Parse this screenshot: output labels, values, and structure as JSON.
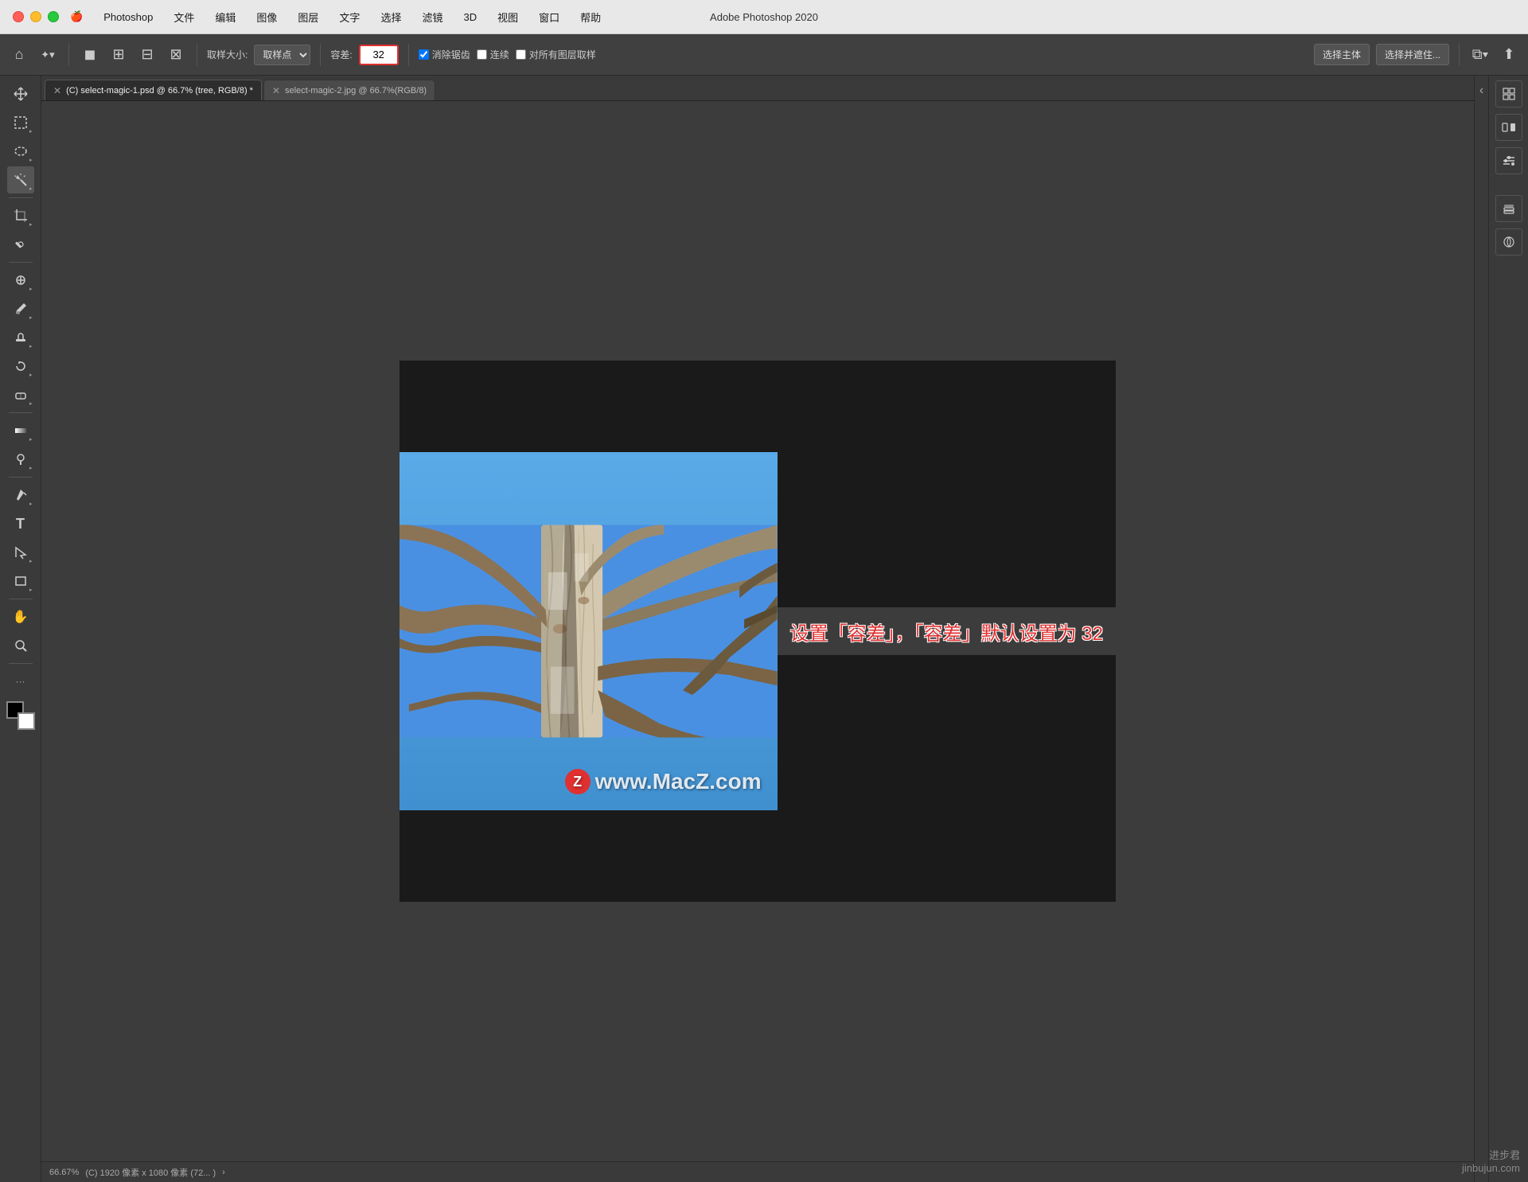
{
  "titlebar": {
    "app_name": "Photoshop",
    "menu_items": [
      "🍎",
      "Photoshop",
      "文件",
      "编辑",
      "图像",
      "图层",
      "文字",
      "选择",
      "滤镜",
      "3D",
      "视图",
      "窗口",
      "帮助"
    ],
    "window_title": "Adobe Photoshop 2020"
  },
  "toolbar": {
    "sample_size_label": "取样大小:",
    "sample_size_value": "取样点",
    "tolerance_label": "容差:",
    "tolerance_value": "32",
    "anti_alias_label": "消除锯齿",
    "anti_alias_checked": true,
    "contiguous_label": "连续",
    "contiguous_checked": false,
    "sample_all_label": "对所有图层取样",
    "sample_all_checked": false,
    "select_subject_label": "选择主体",
    "select_and_mask_label": "选择并遮住..."
  },
  "tabs": [
    {
      "id": "tab1",
      "label": "(C) select-magic-1.psd @ 66.7% (tree, RGB/8) *",
      "active": true
    },
    {
      "id": "tab2",
      "label": "select-magic-2.jpg @ 66.7%(RGB/8)",
      "active": false
    }
  ],
  "tools": [
    {
      "name": "move",
      "icon": "⊹",
      "has_arrow": false
    },
    {
      "name": "marquee",
      "icon": "⬜",
      "has_arrow": true
    },
    {
      "name": "lasso",
      "icon": "⬭",
      "has_arrow": true
    },
    {
      "name": "magic-wand",
      "icon": "✦",
      "has_arrow": true
    },
    {
      "name": "crop",
      "icon": "⧉",
      "has_arrow": true
    },
    {
      "name": "eyedropper",
      "icon": "✒",
      "has_arrow": true
    },
    {
      "name": "heal",
      "icon": "⊕",
      "has_arrow": true
    },
    {
      "name": "brush",
      "icon": "✏",
      "has_arrow": true
    },
    {
      "name": "stamp",
      "icon": "◈",
      "has_arrow": true
    },
    {
      "name": "history",
      "icon": "↩",
      "has_arrow": true
    },
    {
      "name": "eraser",
      "icon": "◻",
      "has_arrow": true
    },
    {
      "name": "gradient",
      "icon": "▦",
      "has_arrow": true
    },
    {
      "name": "dodge",
      "icon": "◯",
      "has_arrow": true
    },
    {
      "name": "pen",
      "icon": "✒",
      "has_arrow": true
    },
    {
      "name": "text",
      "icon": "T",
      "has_arrow": false
    },
    {
      "name": "path-selection",
      "icon": "↗",
      "has_arrow": true
    },
    {
      "name": "rectangle",
      "icon": "□",
      "has_arrow": true
    },
    {
      "name": "hand",
      "icon": "✋",
      "has_arrow": false
    },
    {
      "name": "zoom",
      "icon": "🔍",
      "has_arrow": false
    }
  ],
  "status_bar": {
    "zoom": "66.67%",
    "info": "(C) 1920 像素 x 1080 像素 (72...  )"
  },
  "canvas": {
    "caption": "设置「容差」，「容差」默认设置为 32"
  },
  "watermark": {
    "text": "www.MacZ.com"
  },
  "bottom_right": {
    "line1": "进步君",
    "line2": "jinbujun.com"
  }
}
